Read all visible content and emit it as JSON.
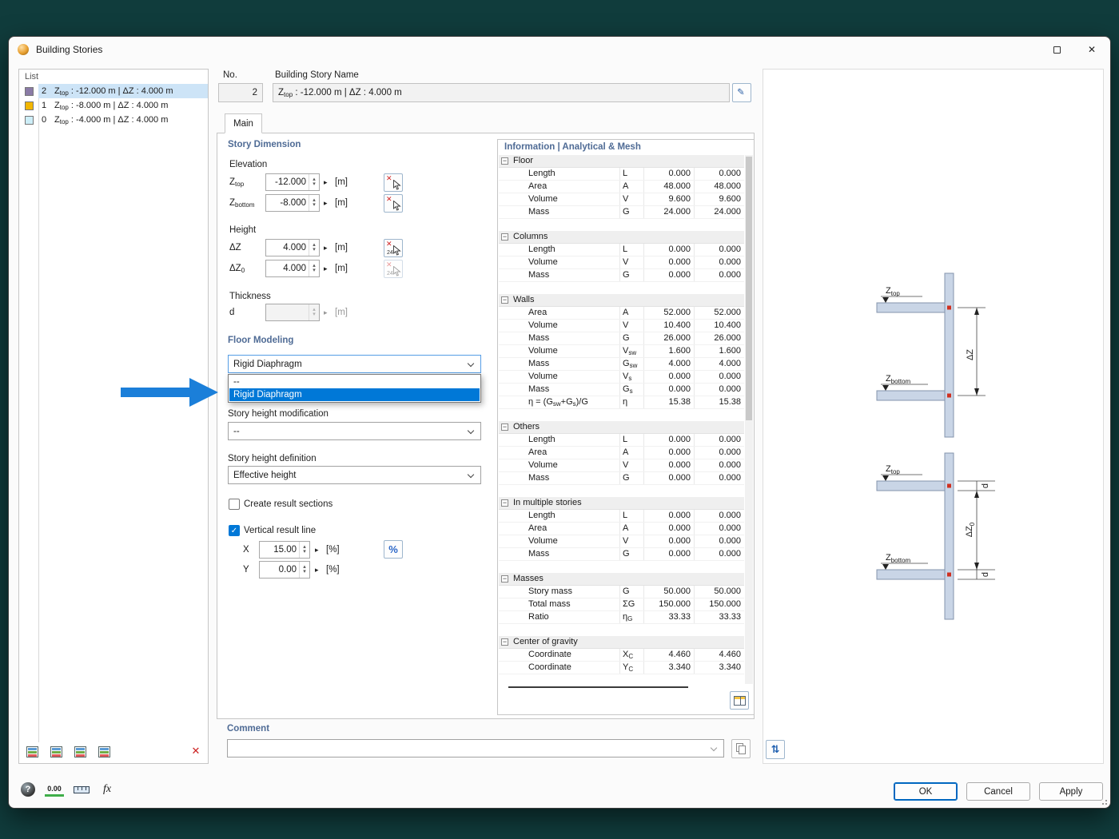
{
  "window": {
    "title": "Building Stories"
  },
  "icons": {
    "close": "✕",
    "check": "✓",
    "spin_up": "▴",
    "spin_down": "▾",
    "flyout": "▸",
    "delete": "✕",
    "collapse": "−",
    "edit": "✎",
    "sync": "⇅",
    "help": "?",
    "fx": "fx",
    "decimal": "0.00",
    "percent": "%",
    "pick24": "24"
  },
  "colors": {
    "accent_blue": "#0078d7",
    "selection_blue": "#cde4f7",
    "annotation_arrow": "#1b7fd9",
    "section_header_text": "#4f6b95",
    "desktop_background": "#103c3c"
  },
  "list_panel": {
    "header": "List",
    "items": [
      {
        "no": "2",
        "label": "Z_{top} : -12.000 m | ΔZ : 4.000 m",
        "color": "#8a7ba6",
        "selected": true
      },
      {
        "no": "1",
        "label": "Z_{top} : -8.000 m | ΔZ : 4.000 m",
        "color": "#f2b600",
        "selected": false
      },
      {
        "no": "0",
        "label": "Z_{top} : -4.000 m | ΔZ : 4.000 m",
        "color": "#cdeef8",
        "selected": false
      }
    ]
  },
  "header": {
    "no_label": "No.",
    "no_value": "2",
    "name_label": "Building Story Name",
    "name_value": "Z_{top} : -12.000 m | ΔZ : 4.000 m"
  },
  "tab": {
    "label": "Main"
  },
  "story_dimension": {
    "title": "Story Dimension",
    "elevation_label": "Elevation",
    "height_label": "Height",
    "thickness_label": "Thickness",
    "rows": [
      {
        "label": "Z_{top}",
        "value": "-12.000",
        "unit": "[m]"
      },
      {
        "label": "Z_{bottom}",
        "value": "-8.000",
        "unit": "[m]"
      },
      {
        "label": "ΔZ",
        "value": "4.000",
        "unit": "[m]"
      },
      {
        "label": "ΔZ_{0}",
        "value": "4.000",
        "unit": "[m]"
      },
      {
        "label": "d",
        "value": "",
        "unit": "[m]"
      }
    ]
  },
  "floor_modeling": {
    "title": "Floor Modeling",
    "combo_value": "Rigid Diaphragm",
    "options": [
      {
        "label": "--",
        "selected": false
      },
      {
        "label": "Rigid Diaphragm",
        "selected": true
      }
    ],
    "story_height_modification_label": "Story height modification",
    "story_height_modification_value": "--",
    "story_height_definition_label": "Story height definition",
    "story_height_definition_value": "Effective height",
    "create_result_sections_label": "Create result sections",
    "create_result_sections_checked": false,
    "vertical_result_line_label": "Vertical result line",
    "vertical_result_line_checked": true,
    "result_line_rows": [
      {
        "label": "X",
        "value": "15.00",
        "unit": "[%]"
      },
      {
        "label": "Y",
        "value": "0.00",
        "unit": "[%]"
      }
    ]
  },
  "information": {
    "title": "Information | Analytical & Mesh",
    "groups": [
      {
        "name": "Floor",
        "rows": [
          {
            "desc": "Length",
            "sym": "L",
            "v1": "0.000",
            "v2": "0.000"
          },
          {
            "desc": "Area",
            "sym": "A",
            "v1": "48.000",
            "v2": "48.000"
          },
          {
            "desc": "Volume",
            "sym": "V",
            "v1": "9.600",
            "v2": "9.600"
          },
          {
            "desc": "Mass",
            "sym": "G",
            "v1": "24.000",
            "v2": "24.000"
          }
        ]
      },
      {
        "name": "Columns",
        "rows": [
          {
            "desc": "Length",
            "sym": "L",
            "v1": "0.000",
            "v2": "0.000"
          },
          {
            "desc": "Volume",
            "sym": "V",
            "v1": "0.000",
            "v2": "0.000"
          },
          {
            "desc": "Mass",
            "sym": "G",
            "v1": "0.000",
            "v2": "0.000"
          }
        ]
      },
      {
        "name": "Walls",
        "rows": [
          {
            "desc": "Area",
            "sym": "A",
            "v1": "52.000",
            "v2": "52.000"
          },
          {
            "desc": "Volume",
            "sym": "V",
            "v1": "10.400",
            "v2": "10.400"
          },
          {
            "desc": "Mass",
            "sym": "G",
            "v1": "26.000",
            "v2": "26.000"
          },
          {
            "desc": "Volume",
            "sym": "V_{sw}",
            "v1": "1.600",
            "v2": "1.600"
          },
          {
            "desc": "Mass",
            "sym": "G_{sw}",
            "v1": "4.000",
            "v2": "4.000"
          },
          {
            "desc": "Volume",
            "sym": "V_{s}",
            "v1": "0.000",
            "v2": "0.000"
          },
          {
            "desc": "Mass",
            "sym": "G_{s}",
            "v1": "0.000",
            "v2": "0.000"
          },
          {
            "desc": "η = (G_{sw}+G_{s})/G",
            "sym": "η",
            "v1": "15.38",
            "v2": "15.38"
          }
        ]
      },
      {
        "name": "Others",
        "rows": [
          {
            "desc": "Length",
            "sym": "L",
            "v1": "0.000",
            "v2": "0.000"
          },
          {
            "desc": "Area",
            "sym": "A",
            "v1": "0.000",
            "v2": "0.000"
          },
          {
            "desc": "Volume",
            "sym": "V",
            "v1": "0.000",
            "v2": "0.000"
          },
          {
            "desc": "Mass",
            "sym": "G",
            "v1": "0.000",
            "v2": "0.000"
          }
        ]
      },
      {
        "name": "In multiple stories",
        "rows": [
          {
            "desc": "Length",
            "sym": "L",
            "v1": "0.000",
            "v2": "0.000"
          },
          {
            "desc": "Area",
            "sym": "A",
            "v1": "0.000",
            "v2": "0.000"
          },
          {
            "desc": "Volume",
            "sym": "V",
            "v1": "0.000",
            "v2": "0.000"
          },
          {
            "desc": "Mass",
            "sym": "G",
            "v1": "0.000",
            "v2": "0.000"
          }
        ]
      },
      {
        "name": "Masses",
        "rows": [
          {
            "desc": "Story mass",
            "sym": "G",
            "v1": "50.000",
            "v2": "50.000"
          },
          {
            "desc": "Total mass",
            "sym": "ΣG",
            "v1": "150.000",
            "v2": "150.000"
          },
          {
            "desc": "Ratio",
            "sym": "η_{G}",
            "v1": "33.33",
            "v2": "33.33"
          }
        ]
      },
      {
        "name": "Center of gravity",
        "rows": [
          {
            "desc": "Coordinate",
            "sym": "X_{C}",
            "v1": "4.460",
            "v2": "4.460"
          },
          {
            "desc": "Coordinate",
            "sym": "Y_{C}",
            "v1": "3.340",
            "v2": "3.340"
          }
        ]
      }
    ]
  },
  "diagram": {
    "z_base": "Z",
    "top_sub": "top",
    "bottom_sub": "bottom",
    "dz_label": "ΔZ",
    "dz0_base": "ΔZ",
    "dz0_sub": "0",
    "d_label": "d"
  },
  "comment": {
    "title": "Comment",
    "value": ""
  },
  "footer": {
    "ok": "OK",
    "cancel": "Cancel",
    "apply": "Apply"
  }
}
